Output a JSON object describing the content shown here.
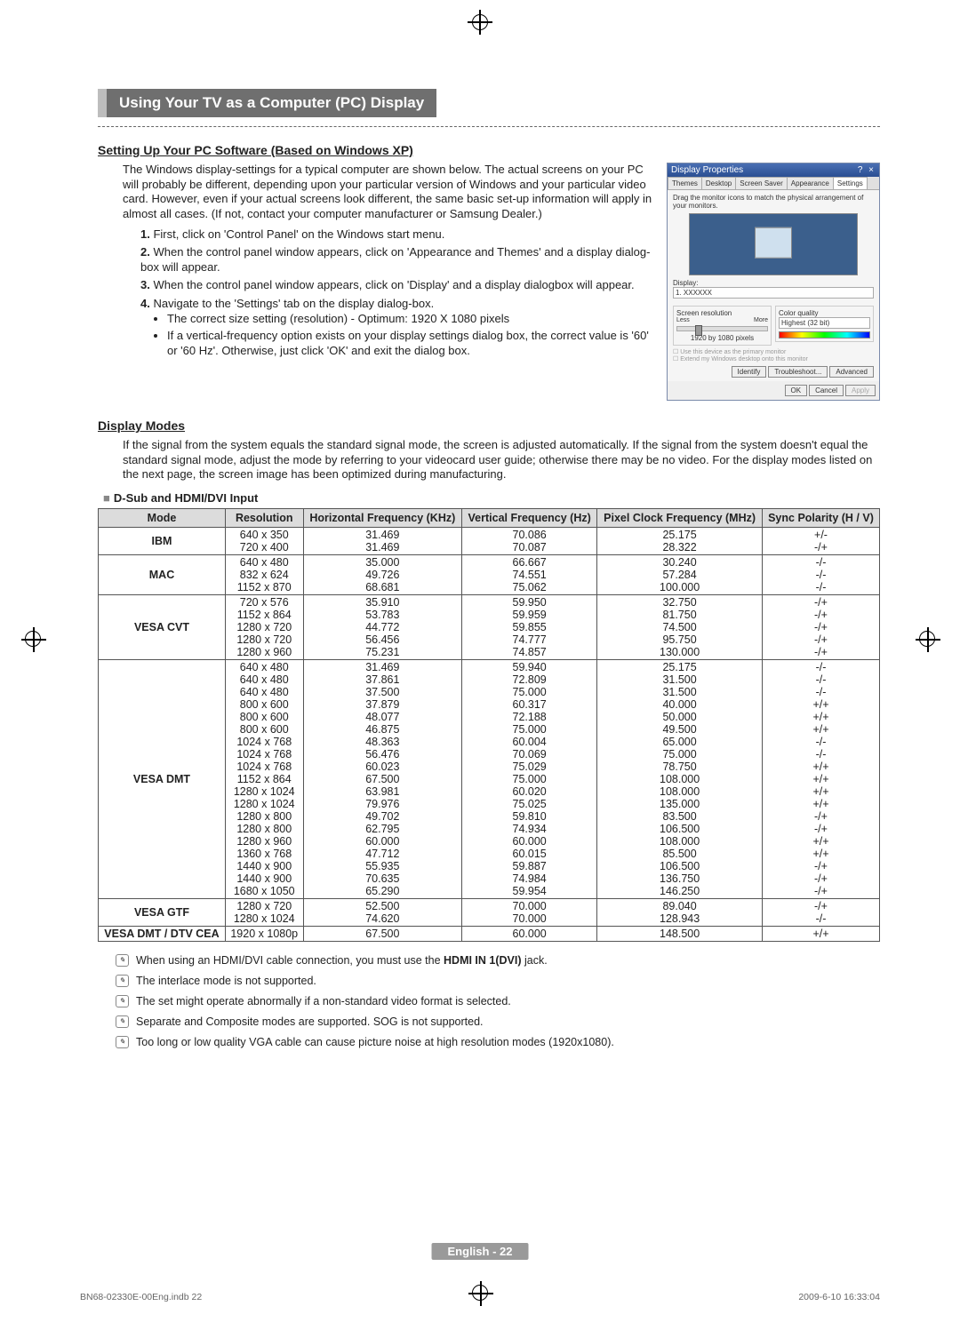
{
  "section_title": "Using Your TV as a Computer (PC) Display",
  "setup_heading": "Setting Up Your PC Software (Based on Windows XP)",
  "intro_para": "The Windows display-settings for a typical computer are shown below. The actual screens on your PC will probably be different, depending upon your particular version of Windows and your particular video card. However, even if your actual screens look different, the same basic set-up information will apply in almost all cases. (If not, contact your computer manufacturer or Samsung Dealer.)",
  "steps": [
    "First, click on 'Control Panel' on the Windows start menu.",
    "When the control panel window appears, click on 'Appearance and Themes' and a display dialog-box will appear.",
    "When the control panel window appears, click on 'Display' and a display dialogbox will appear.",
    "Navigate to the 'Settings' tab on the display dialog-box."
  ],
  "step4_bullets": [
    "The correct size setting (resolution) - Optimum: 1920 X 1080 pixels",
    "If a vertical-frequency option exists on your display settings dialog box, the correct value is '60' or '60 Hz'. Otherwise, just click 'OK' and exit the dialog box."
  ],
  "dialog": {
    "title": "Display Properties",
    "title_btns": "? ×",
    "tabs": [
      "Themes",
      "Desktop",
      "Screen Saver",
      "Appearance",
      "Settings"
    ],
    "drag_note": "Drag the monitor icons to match the physical arrangement of your monitors.",
    "display_label": "Display:",
    "display_value": "1. XXXXXX",
    "res_label": "Screen resolution",
    "res_less": "Less",
    "res_more": "More",
    "res_value": "1920 by 1080 pixels",
    "cq_label": "Color quality",
    "cq_value": "Highest (32 bit)",
    "chk1": "Use this device as the primary monitor",
    "chk2": "Extend my Windows desktop onto this monitor",
    "btns_row1": [
      "Identify",
      "Troubleshoot...",
      "Advanced"
    ],
    "btns_row2": [
      "OK",
      "Cancel",
      "Apply"
    ]
  },
  "display_modes_heading": "Display Modes",
  "display_modes_para": "If the signal from the system equals the standard signal mode, the screen is adjusted automatically. If the signal from the system doesn't equal the standard signal mode, adjust the mode by referring to your videocard user guide; otherwise there may be no video. For the display modes listed on the next page, the screen image has been optimized during manufacturing.",
  "table_heading": "D-Sub and HDMI/DVI Input",
  "table_headers": [
    "Mode",
    "Resolution",
    "Horizontal Frequency (KHz)",
    "Vertical Frequency (Hz)",
    "Pixel Clock Frequency (MHz)",
    "Sync Polarity (H / V)"
  ],
  "table_rows": [
    {
      "mode": "IBM",
      "res": [
        "640 x 350",
        "720 x 400"
      ],
      "h": [
        "31.469",
        "31.469"
      ],
      "v": [
        "70.086",
        "70.087"
      ],
      "p": [
        "25.175",
        "28.322"
      ],
      "s": [
        "+/-",
        "-/+"
      ]
    },
    {
      "mode": "MAC",
      "res": [
        "640 x 480",
        "832 x 624",
        "1152 x 870"
      ],
      "h": [
        "35.000",
        "49.726",
        "68.681"
      ],
      "v": [
        "66.667",
        "74.551",
        "75.062"
      ],
      "p": [
        "30.240",
        "57.284",
        "100.000"
      ],
      "s": [
        "-/-",
        "-/-",
        "-/-"
      ]
    },
    {
      "mode": "VESA CVT",
      "res": [
        "720 x 576",
        "1152 x 864",
        "1280 x 720",
        "1280 x 720",
        "1280 x 960"
      ],
      "h": [
        "35.910",
        "53.783",
        "44.772",
        "56.456",
        "75.231"
      ],
      "v": [
        "59.950",
        "59.959",
        "59.855",
        "74.777",
        "74.857"
      ],
      "p": [
        "32.750",
        "81.750",
        "74.500",
        "95.750",
        "130.000"
      ],
      "s": [
        "-/+",
        "-/+",
        "-/+",
        "-/+",
        "-/+"
      ]
    },
    {
      "mode": "VESA DMT",
      "res": [
        "640 x 480",
        "640 x 480",
        "640 x 480",
        "800 x 600",
        "800 x 600",
        "800 x 600",
        "1024 x 768",
        "1024 x 768",
        "1024 x 768",
        "1152 x 864",
        "1280 x 1024",
        "1280 x 1024",
        "1280 x 800",
        "1280 x 800",
        "1280 x 960",
        "1360 x 768",
        "1440 x 900",
        "1440 x 900",
        "1680 x 1050"
      ],
      "h": [
        "31.469",
        "37.861",
        "37.500",
        "37.879",
        "48.077",
        "46.875",
        "48.363",
        "56.476",
        "60.023",
        "67.500",
        "63.981",
        "79.976",
        "49.702",
        "62.795",
        "60.000",
        "47.712",
        "55.935",
        "70.635",
        "65.290"
      ],
      "v": [
        "59.940",
        "72.809",
        "75.000",
        "60.317",
        "72.188",
        "75.000",
        "60.004",
        "70.069",
        "75.029",
        "75.000",
        "60.020",
        "75.025",
        "59.810",
        "74.934",
        "60.000",
        "60.015",
        "59.887",
        "74.984",
        "59.954"
      ],
      "p": [
        "25.175",
        "31.500",
        "31.500",
        "40.000",
        "50.000",
        "49.500",
        "65.000",
        "75.000",
        "78.750",
        "108.000",
        "108.000",
        "135.000",
        "83.500",
        "106.500",
        "108.000",
        "85.500",
        "106.500",
        "136.750",
        "146.250"
      ],
      "s": [
        "-/-",
        "-/-",
        "-/-",
        "+/+",
        "+/+",
        "+/+",
        "-/-",
        "-/-",
        "+/+",
        "+/+",
        "+/+",
        "+/+",
        "-/+",
        "-/+",
        "+/+",
        "+/+",
        "-/+",
        "-/+",
        "-/+"
      ]
    },
    {
      "mode": "VESA GTF",
      "res": [
        "1280 x 720",
        "1280 x 1024"
      ],
      "h": [
        "52.500",
        "74.620"
      ],
      "v": [
        "70.000",
        "70.000"
      ],
      "p": [
        "89.040",
        "128.943"
      ],
      "s": [
        "-/+",
        "-/-"
      ]
    },
    {
      "mode": "VESA DMT / DTV CEA",
      "res": [
        "1920 x 1080p"
      ],
      "h": [
        "67.500"
      ],
      "v": [
        "60.000"
      ],
      "p": [
        "148.500"
      ],
      "s": [
        "+/+"
      ]
    }
  ],
  "notes": [
    "When using an HDMI/DVI cable connection, you must use the HDMI IN 1(DVI) jack.",
    "The interlace mode is not supported.",
    "The set might operate abnormally if a non-standard video format is selected.",
    "Separate and Composite modes are supported. SOG is not supported.",
    "Too long or low quality VGA cable can cause picture noise at high resolution modes (1920x1080)."
  ],
  "footer_center": "English - 22",
  "footer_left": "BN68-02330E-00Eng.indb   22",
  "footer_right": "2009-6-10   16:33:04"
}
